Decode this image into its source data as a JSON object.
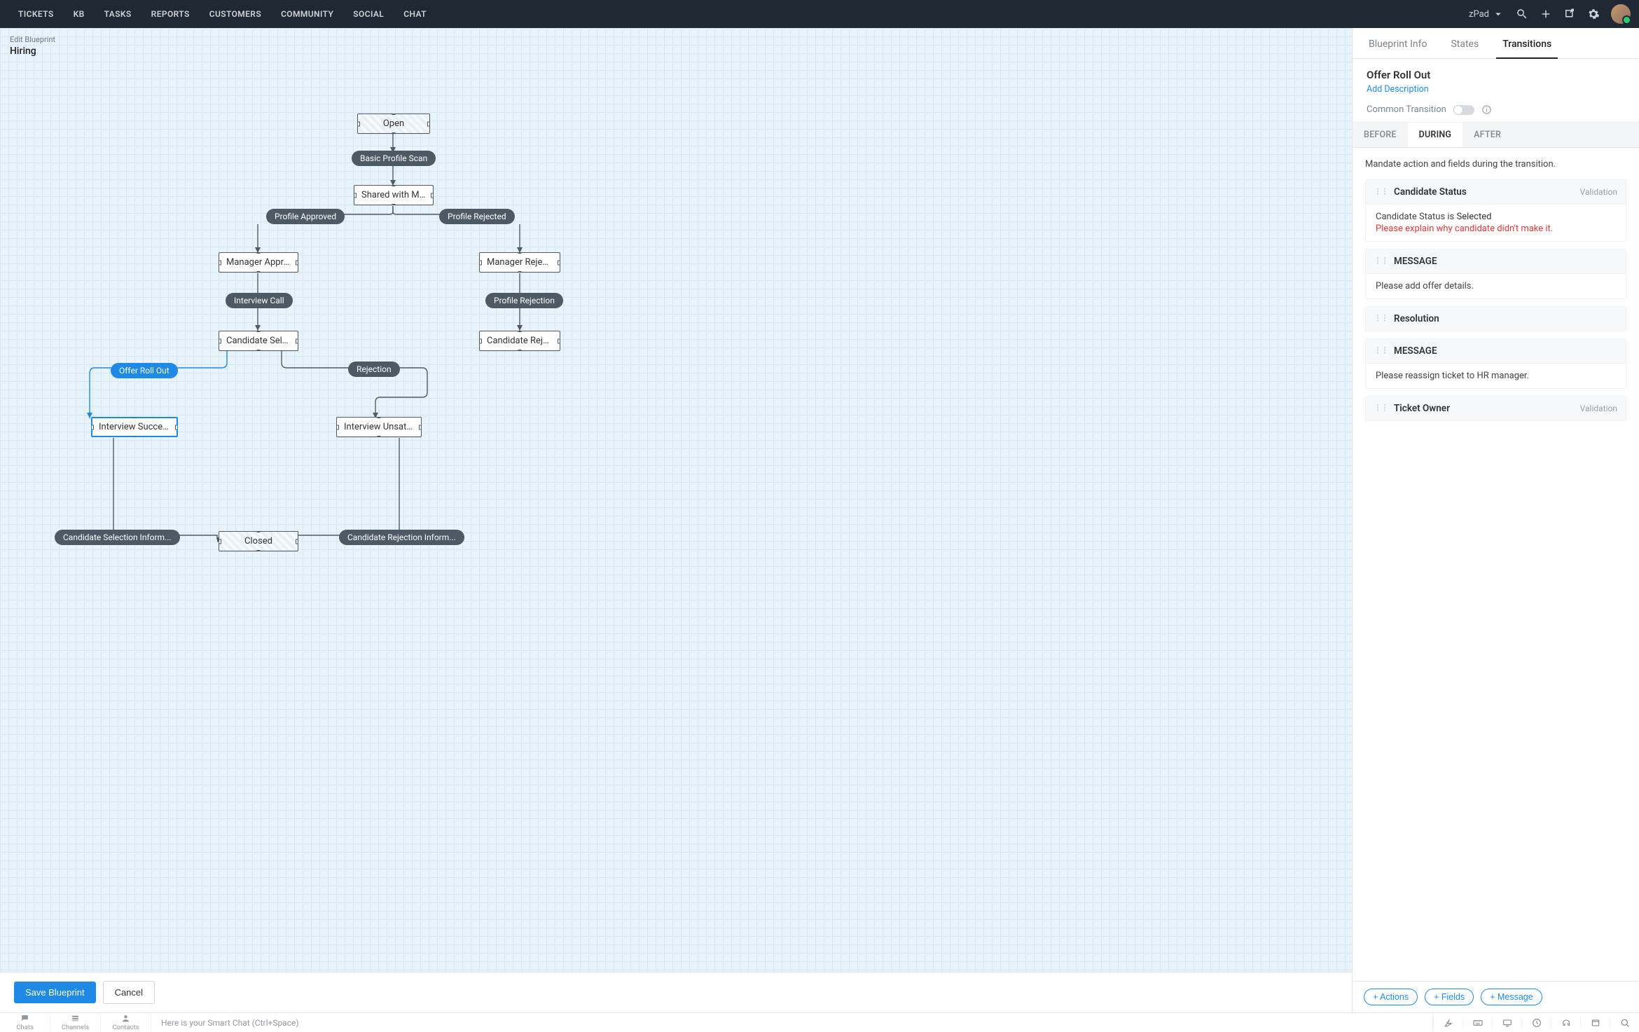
{
  "topnav": {
    "items": [
      "TICKETS",
      "KB",
      "TASKS",
      "REPORTS",
      "CUSTOMERS",
      "COMMUNITY",
      "SOCIAL",
      "CHAT"
    ],
    "workspace": "zPad"
  },
  "blueprint": {
    "edit_label": "Edit Blueprint",
    "name": "Hiring"
  },
  "nodes": {
    "open": "Open",
    "shared": "Shared with Mana...",
    "mgr_approved": "Manager Approved",
    "mgr_rejected": "Manager Rejected",
    "cand_select": "Candidate Select...",
    "cand_reject": "Candidate Reject...",
    "int_success": "Interview Success...",
    "int_unsat": "Interview Unsatisf...",
    "closed": "Closed"
  },
  "transitions": {
    "basic_scan": "Basic Profile Scan",
    "profile_approved": "Profile Approved",
    "profile_rejected": "Profile Rejected",
    "interview_call": "Interview Call",
    "profile_rejection": "Profile Rejection",
    "offer_roll_out": "Offer Roll Out",
    "rejection": "Rejection",
    "cand_sel_info": "Candidate Selection Inform...",
    "cand_rej_info": "Candidate Rejection Inform..."
  },
  "canvas_footer": {
    "save": "Save Blueprint",
    "cancel": "Cancel"
  },
  "panel": {
    "tabs": {
      "info": "Blueprint Info",
      "states": "States",
      "transitions": "Transitions"
    },
    "title": "Offer Roll Out",
    "add_desc": "Add Description",
    "common_label": "Common Transition",
    "stage": {
      "before": "BEFORE",
      "during": "DURING",
      "after": "AFTER"
    },
    "hint": "Mandate action and fields during the transition.",
    "cards": [
      {
        "title": "Candidate Status",
        "badge": "Validation",
        "body1_prefix": "Candidate Status is",
        "body1_value": "Selected",
        "body2": "Please explain why candidate didn't make it."
      },
      {
        "title": "MESSAGE",
        "badge": "",
        "body1": "Please add offer details."
      },
      {
        "title": "Resolution",
        "badge": "",
        "body": null
      },
      {
        "title": "MESSAGE",
        "badge": "",
        "body1": "Please reassign ticket to HR manager."
      },
      {
        "title": "Ticket Owner",
        "badge": "Validation",
        "body": null
      }
    ],
    "footer": {
      "actions": "+ Actions",
      "fields": "+ Fields",
      "message": "+ Message"
    }
  },
  "bottombar": {
    "tabs": [
      "Chats",
      "Channels",
      "Contacts"
    ],
    "smartchat": "Here is your Smart Chat (Ctrl+Space)"
  }
}
